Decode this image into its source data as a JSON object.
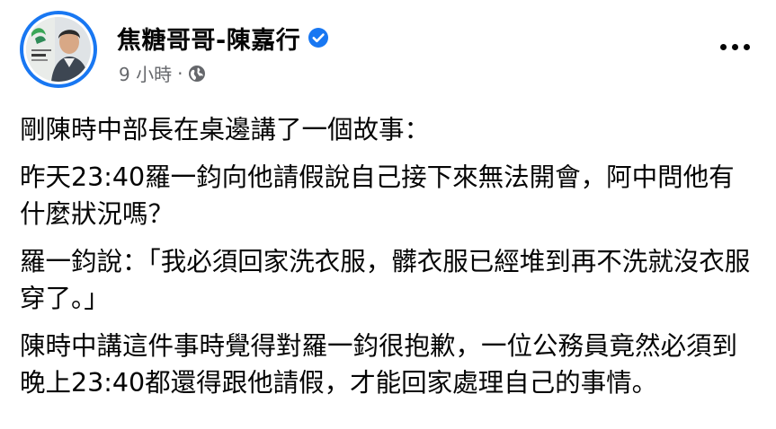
{
  "post": {
    "author": {
      "name": "焦糖哥哥-陳嘉行",
      "verified": true
    },
    "meta": {
      "time": "9 小時",
      "separator": "·",
      "audience_icon": "globe-icon"
    },
    "more_icon": "more-options-icon",
    "paragraphs": [
      "剛陳時中部長在桌邊講了一個故事：",
      "昨天23:40羅一鈞向他請假說自己接下來無法開會，阿中問他有什麼狀況嗎？",
      "羅一鈞說：「我必須回家洗衣服，髒衣服已經堆到再不洗就沒衣服穿了。」",
      "陳時中講這件事時覺得對羅一鈞很抱歉，一位公務員竟然必須到晚上23:40都還得跟他請假，才能回家處理自己的事情。"
    ]
  },
  "colors": {
    "brand_blue": "#1877f2",
    "text_primary": "#050505",
    "text_secondary": "#65676b"
  }
}
